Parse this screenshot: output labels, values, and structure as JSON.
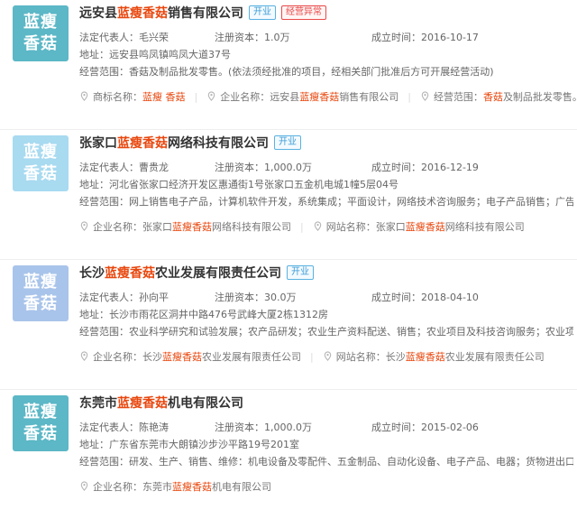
{
  "companies": [
    {
      "logo": [
        "蓝瘦",
        "香菇"
      ],
      "logo_color": "#5cb7c6",
      "name_pre": "远安县",
      "name_hl": "蓝瘦香菇",
      "name_post": "销售有限公司",
      "tags": [
        {
          "text": "开业",
          "type": "open"
        },
        {
          "text": "经营异常",
          "type": "abn"
        }
      ],
      "rep_label": "法定代表人：",
      "rep": "毛兴荣",
      "capital_label": "注册资本：",
      "capital": "1.0万",
      "date_label": "成立时间：",
      "date": "2016-10-17",
      "address_label": "地址：",
      "address": "远安县鸣凤镇鸣凤大道37号",
      "scope_label": "经营范围：",
      "scope": "香菇及制品批发零售。(依法须经批准的项目，经相关部门批准后方可开展经营活动)",
      "links": [
        {
          "label": "商标名称：",
          "parts": [
            {
              "t": "蓝瘦 香菇",
              "hl": true
            }
          ]
        },
        {
          "label": "企业名称：",
          "parts": [
            {
              "t": "远安县",
              "hl": false
            },
            {
              "t": "蓝瘦香菇",
              "hl": true
            },
            {
              "t": "销售有限公司",
              "hl": false
            }
          ]
        },
        {
          "label": "经营范围：",
          "parts": [
            {
              "t": "香菇",
              "hl": true
            },
            {
              "t": "及制品批发零售。(依法须...",
              "hl": false
            }
          ]
        }
      ]
    },
    {
      "logo": [
        "蓝瘦",
        "香菇"
      ],
      "logo_color": "#a8daf0",
      "name_pre": "张家口",
      "name_hl": "蓝瘦香菇",
      "name_post": "网络科技有限公司",
      "tags": [
        {
          "text": "开业",
          "type": "open"
        }
      ],
      "rep_label": "法定代表人：",
      "rep": "曹贵龙",
      "capital_label": "注册资本：",
      "capital": "1,000.0万",
      "date_label": "成立时间：",
      "date": "2016-12-19",
      "address_label": "地址：",
      "address": "河北省张家口经济开发区惠通街1号张家口五金机电城1幢5层04号",
      "scope_label": "经营范围：",
      "scope": "网上销售电子产品，计算机软件开发，系统集成；平面设计，网络技术咨询服务；电子产品销售；广告设计...",
      "links": [
        {
          "label": "企业名称：",
          "parts": [
            {
              "t": "张家口",
              "hl": false
            },
            {
              "t": "蓝瘦香菇",
              "hl": true
            },
            {
              "t": "网络科技有限公司",
              "hl": false
            }
          ]
        },
        {
          "label": "网站名称：",
          "parts": [
            {
              "t": "张家口",
              "hl": false
            },
            {
              "t": "蓝瘦香菇",
              "hl": true
            },
            {
              "t": "网络科技有限公司",
              "hl": false
            }
          ]
        }
      ]
    },
    {
      "logo": [
        "蓝瘦",
        "香菇"
      ],
      "logo_color": "#a9c4ea",
      "name_pre": "长沙",
      "name_hl": "蓝瘦香菇",
      "name_post": "农业发展有限责任公司",
      "tags": [
        {
          "text": "开业",
          "type": "open"
        }
      ],
      "rep_label": "法定代表人：",
      "rep": "孙向平",
      "capital_label": "注册资本：",
      "capital": "30.0万",
      "date_label": "成立时间：",
      "date": "2018-04-10",
      "address_label": "地址：",
      "address": "长沙市雨花区洞井中路476号武峰大厦2栋1312房",
      "scope_label": "经营范围：",
      "scope": "农业科学研究和试验发展；农产品研发；农业生产资料配送、销售；农业项目及科技咨询服务；农业项目规...",
      "links": [
        {
          "label": "企业名称：",
          "parts": [
            {
              "t": "长沙",
              "hl": false
            },
            {
              "t": "蓝瘦香菇",
              "hl": true
            },
            {
              "t": "农业发展有限责任公司",
              "hl": false
            }
          ]
        },
        {
          "label": "网站名称：",
          "parts": [
            {
              "t": "长沙",
              "hl": false
            },
            {
              "t": "蓝瘦香菇",
              "hl": true
            },
            {
              "t": "农业发展有限责任公司",
              "hl": false
            }
          ]
        }
      ]
    },
    {
      "logo": [
        "蓝瘦",
        "香菇"
      ],
      "logo_color": "#5cb7c6",
      "name_pre": "东莞市",
      "name_hl": "蓝瘦香菇",
      "name_post": "机电有限公司",
      "tags": [],
      "rep_label": "法定代表人：",
      "rep": "陈艳涛",
      "capital_label": "注册资本：",
      "capital": "1,000.0万",
      "date_label": "成立时间：",
      "date": "2015-02-06",
      "address_label": "地址：",
      "address": "广东省东莞市大朗镇沙步沙平路19号201室",
      "scope_label": "经营范围：",
      "scope": "研发、生产、销售、维修：机电设备及零配件、五金制品、自动化设备、电子产品、电器；货物进出口、技...",
      "links": [
        {
          "label": "企业名称：",
          "parts": [
            {
              "t": "东莞市",
              "hl": false
            },
            {
              "t": "蓝瘦香菇",
              "hl": true
            },
            {
              "t": "机电有限公司",
              "hl": false
            }
          ]
        }
      ]
    }
  ]
}
